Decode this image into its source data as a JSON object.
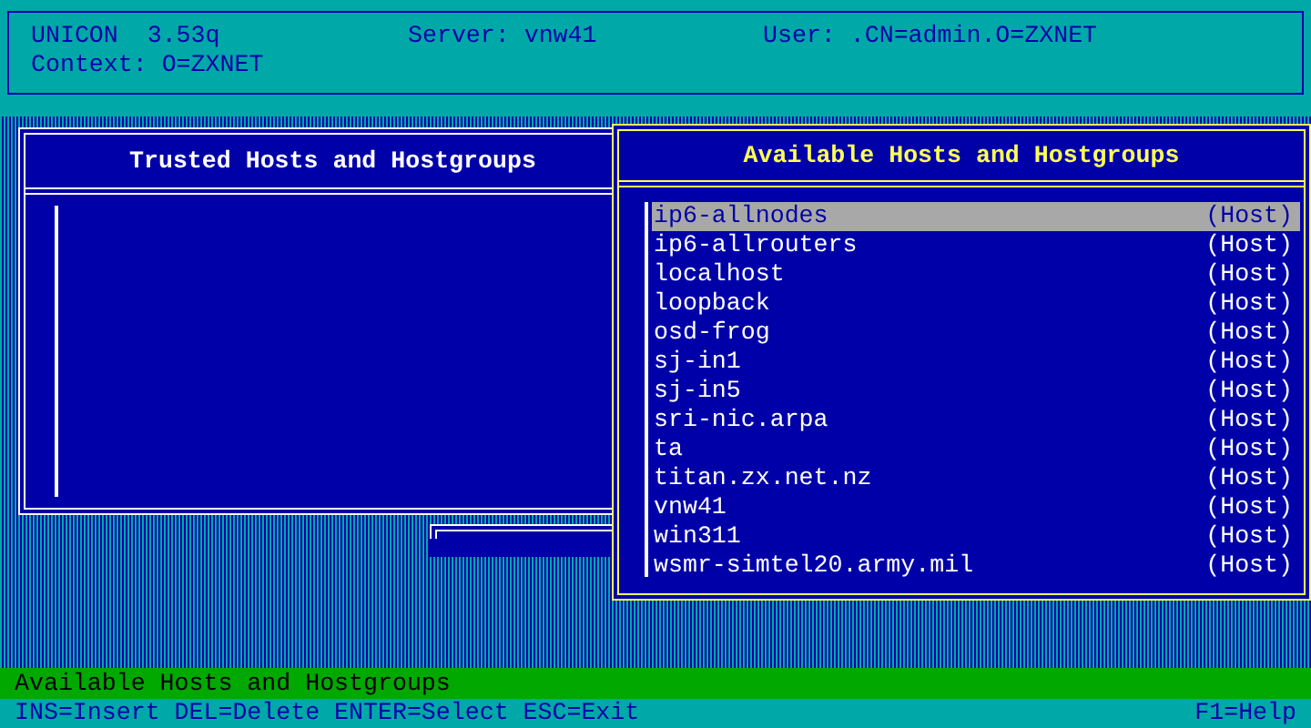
{
  "header": {
    "app": "UNICON  3.53q",
    "server": "Server: vnw41",
    "user": "User: .CN=admin.O=ZXNET",
    "context": "Context: O=ZXNET"
  },
  "trusted_panel": {
    "title": "Trusted Hosts and Hostgroups",
    "active": false
  },
  "available_panel": {
    "title": "Available Hosts and Hostgroups",
    "active": true,
    "items": [
      {
        "name": "ip6-allnodes",
        "type": "(Host)",
        "selected": true
      },
      {
        "name": "ip6-allrouters",
        "type": "(Host)",
        "selected": false
      },
      {
        "name": "localhost",
        "type": "(Host)",
        "selected": false
      },
      {
        "name": "loopback",
        "type": "(Host)",
        "selected": false
      },
      {
        "name": "osd-frog",
        "type": "(Host)",
        "selected": false
      },
      {
        "name": "sj-in1",
        "type": "(Host)",
        "selected": false
      },
      {
        "name": "sj-in5",
        "type": "(Host)",
        "selected": false
      },
      {
        "name": "sri-nic.arpa",
        "type": "(Host)",
        "selected": false
      },
      {
        "name": "ta",
        "type": "(Host)",
        "selected": false
      },
      {
        "name": "titan.zx.net.nz",
        "type": "(Host)",
        "selected": false
      },
      {
        "name": "vnw41",
        "type": "(Host)",
        "selected": false
      },
      {
        "name": "win311",
        "type": "(Host)",
        "selected": false
      },
      {
        "name": "wsmr-simtel20.army.mil",
        "type": "(Host)",
        "selected": false
      }
    ]
  },
  "status_bar": {
    "message": "Available Hosts and Hostgroups",
    "keys": "INS=Insert DEL=Delete ENTER=Select ESC=Exit",
    "help": "F1=Help"
  }
}
